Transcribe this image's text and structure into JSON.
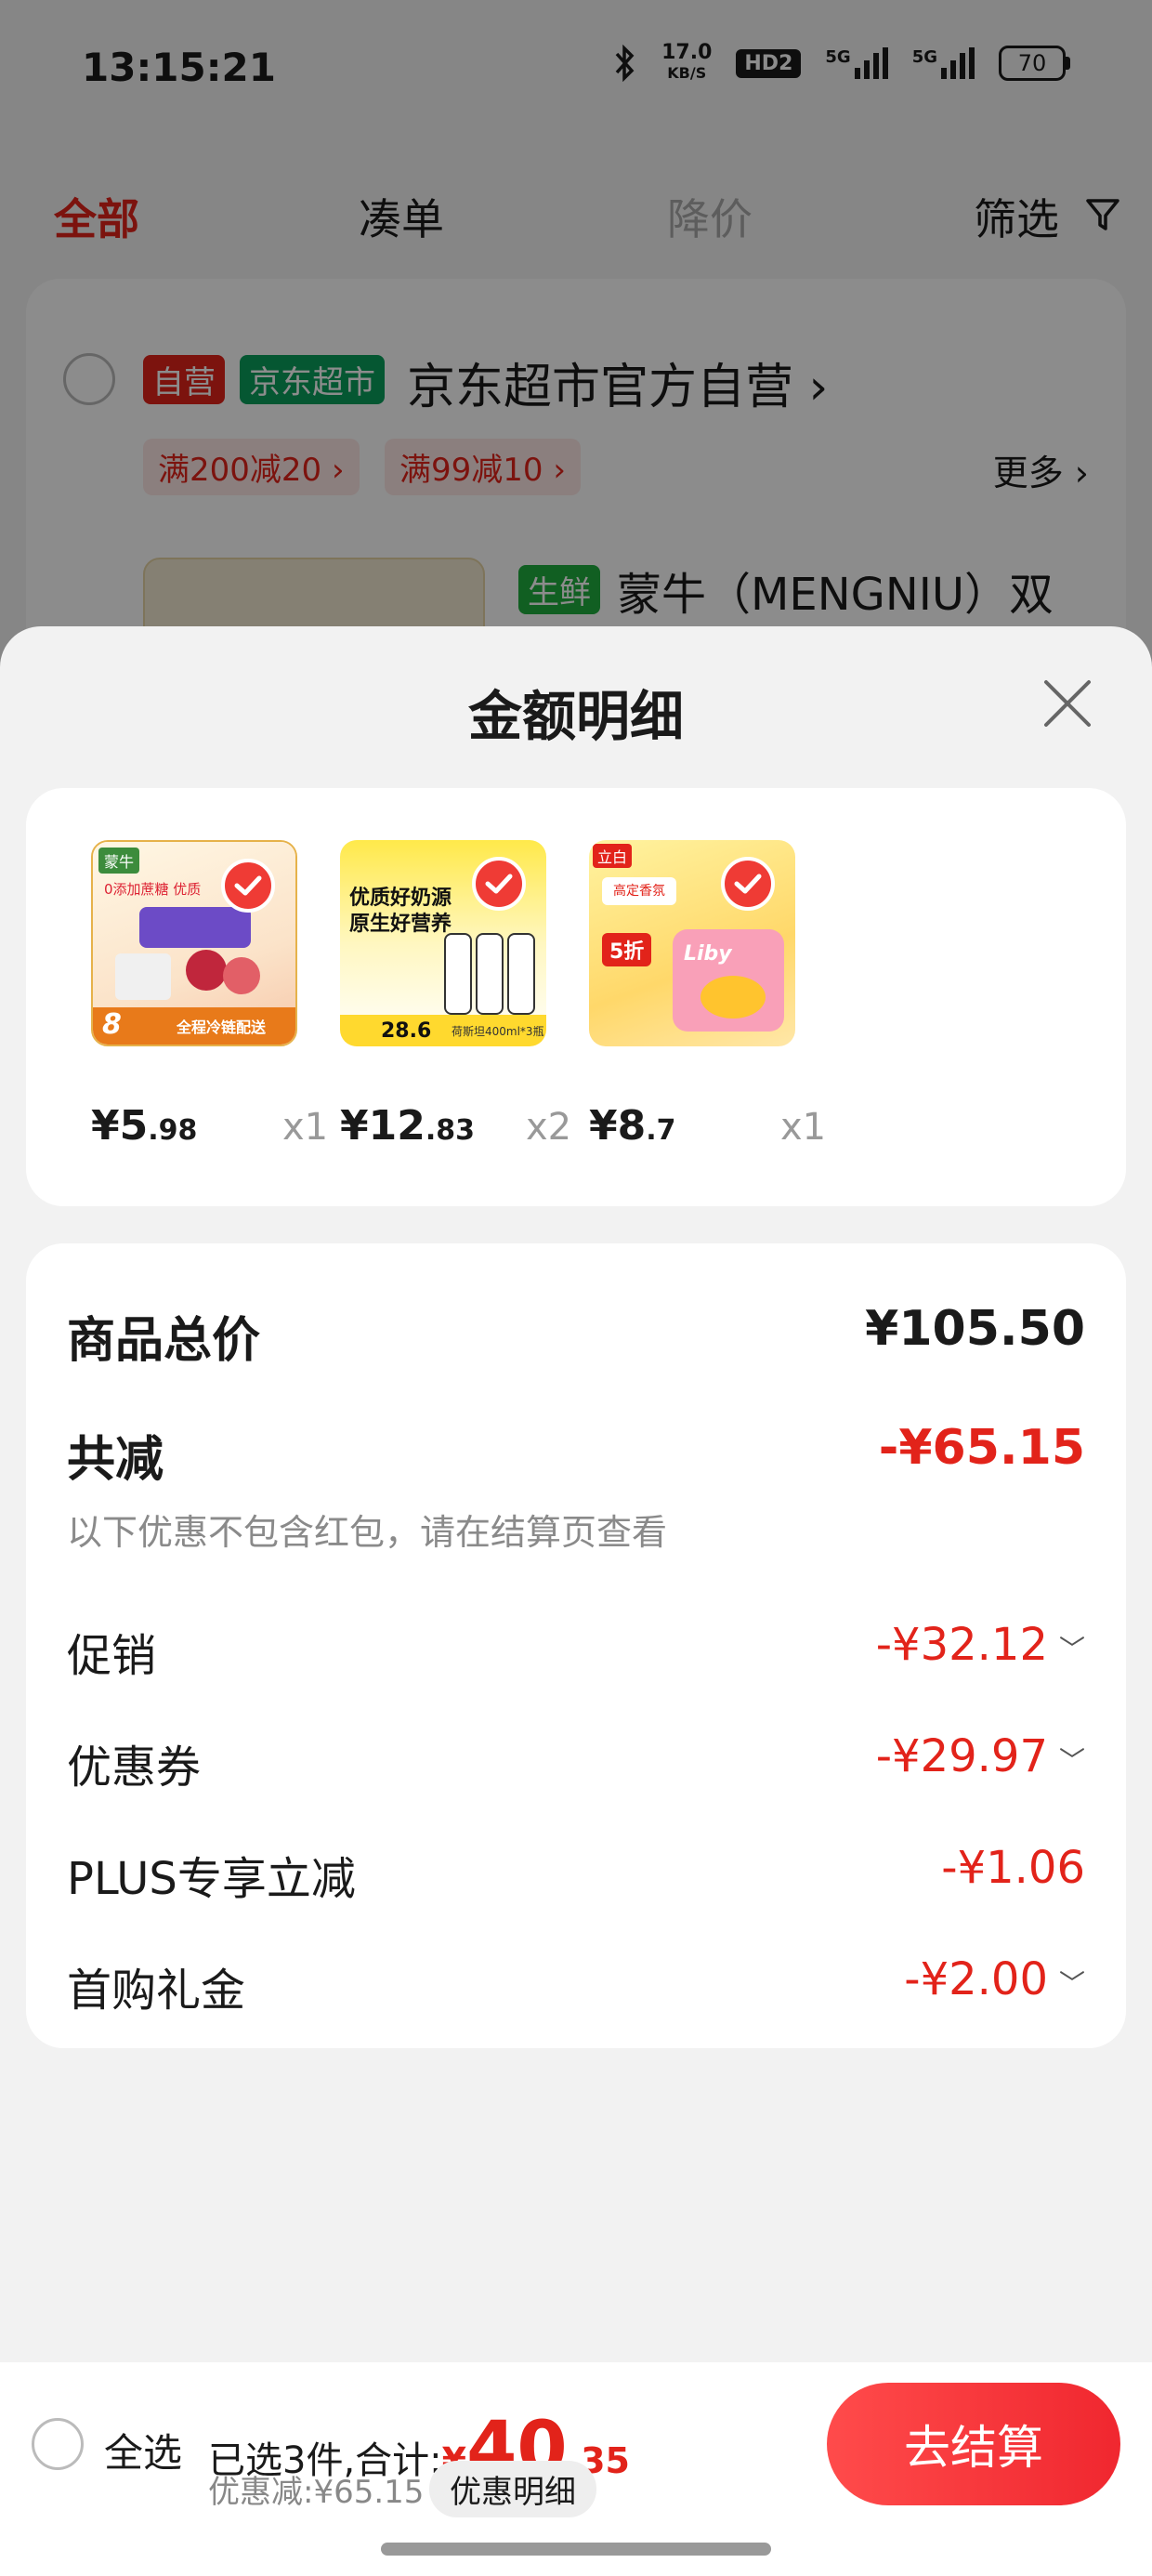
{
  "status_bar": {
    "time": "13:15:21",
    "net_speed_value": "17.0",
    "net_speed_unit": "KB/S",
    "hd_badge": "HD2",
    "sig1_label": "5G",
    "sig2_label": "5G",
    "battery": "70"
  },
  "filter_tabs": [
    {
      "label": "全部",
      "active": true
    },
    {
      "label": "凑单",
      "active": false
    },
    {
      "label": "降价",
      "active": false
    },
    {
      "label": "筛选",
      "active": false
    }
  ],
  "shop": {
    "tag_self": "自营",
    "tag_market": "京东超市",
    "name": "京东超市官方自营",
    "coupons": [
      "满200减20 ›",
      "满99减10 ›"
    ],
    "more": "更多 ›",
    "product_tag": "生鲜",
    "product_name": "蒙牛（MENGNIU）双"
  },
  "sheet": {
    "title": "金额明细",
    "items": [
      {
        "price_int": "¥5",
        "price_dec": ".98",
        "qty": "x1",
        "img_text_1": "蒙牛",
        "img_text_2": "8",
        "img_text_3": "全程冷链配送",
        "img_text_4": "0添加蔗糖 优质"
      },
      {
        "price_int": "¥12",
        "price_dec": ".83",
        "qty": "x2",
        "img_text_1": "优质好奶源",
        "img_text_2": "原生好营养",
        "img_text_3": "28.6",
        "img_text_4": "荷斯坦400ml*3瓶"
      },
      {
        "price_int": "¥8",
        "price_dec": ".7",
        "qty": "x1",
        "img_text_1": "立白",
        "img_text_2": "Liby",
        "img_text_3": "5折",
        "img_text_4": "高定香氛"
      }
    ],
    "summary": {
      "total_label": "商品总价",
      "total_value": "¥105.50",
      "reduce_label": "共减",
      "reduce_value": "-¥65.15",
      "note": "以下优惠不包含红包，请在结算页查看",
      "rows": [
        {
          "label": "促销",
          "value": "-¥32.12",
          "expandable": true
        },
        {
          "label": "优惠券",
          "value": "-¥29.97",
          "expandable": true
        },
        {
          "label": "PLUS专享立减",
          "value": "-¥1.06",
          "expandable": false
        },
        {
          "label": "首购礼金",
          "value": "-¥2.00",
          "expandable": true
        }
      ]
    }
  },
  "bottom_bar": {
    "select_all": "全选",
    "selected_text": "已选3件,合计:",
    "total_sym": "¥",
    "total_int": "40",
    "total_dec": ".35",
    "discount": "优惠减:¥65.15",
    "detail_btn": "优惠明细",
    "checkout": "去结算"
  },
  "colors": {
    "accent_red": "#e2231a",
    "checkout_gradient": [
      "#ff4b4b",
      "#f0272f"
    ],
    "jd_green": "#0a9e5c"
  }
}
